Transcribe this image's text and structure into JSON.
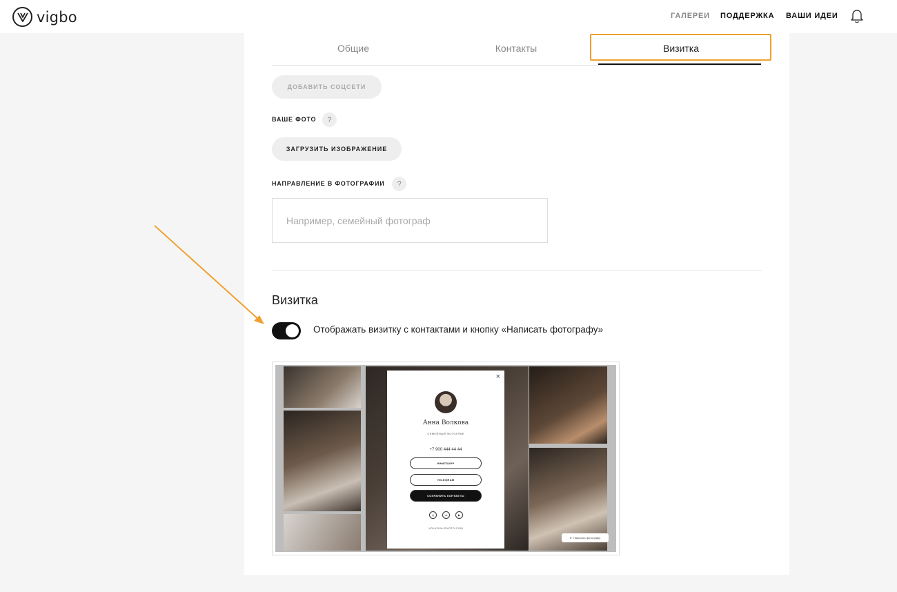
{
  "header": {
    "logo_text": "vigbo",
    "nav": [
      "ГАЛЕРЕИ",
      "ПОДДЕРЖКА",
      "ВАШИ ИДЕИ"
    ],
    "notification_icon": "bell-icon"
  },
  "tabs": [
    {
      "label": "Общие",
      "active": false
    },
    {
      "label": "Контакты",
      "active": false
    },
    {
      "label": "Визитка",
      "active": true
    }
  ],
  "form": {
    "add_social_label": "ДОБАВИТЬ СОЦСЕТИ",
    "photo_label": "ВАШЕ ФОТО",
    "upload_label": "ЗАГРУЗИТЬ ИЗОБРАЖЕНИЕ",
    "direction_label": "НАПРАВЛЕНИЕ В ФОТОГРАФИИ",
    "direction_placeholder": "Например, семейный фотограф",
    "help_glyph": "?"
  },
  "card_section": {
    "title": "Визитка",
    "toggle_on": true,
    "toggle_label": "Отображать визитку с контактами и кнопку «Написать фотографу»"
  },
  "preview": {
    "close_glyph": "×",
    "name": "Анна Волкова",
    "role": "СЕМЕЙНЫЙ ФОТОГРАФ",
    "phone": "+7 900 444 44 44",
    "buttons": [
      "WHATSAPP",
      "TELEGRAM",
      "СОХРАНИТЬ КОНТАКТЫ"
    ],
    "social_icons": [
      "instagram-icon",
      "vk-icon",
      "youtube-icon"
    ],
    "site": "VOLKOVA-PHOTO.COM",
    "write_button": "Написать фотографу"
  },
  "colors": {
    "accent_highlight": "#f0a030",
    "toggle_on": "#111111"
  }
}
